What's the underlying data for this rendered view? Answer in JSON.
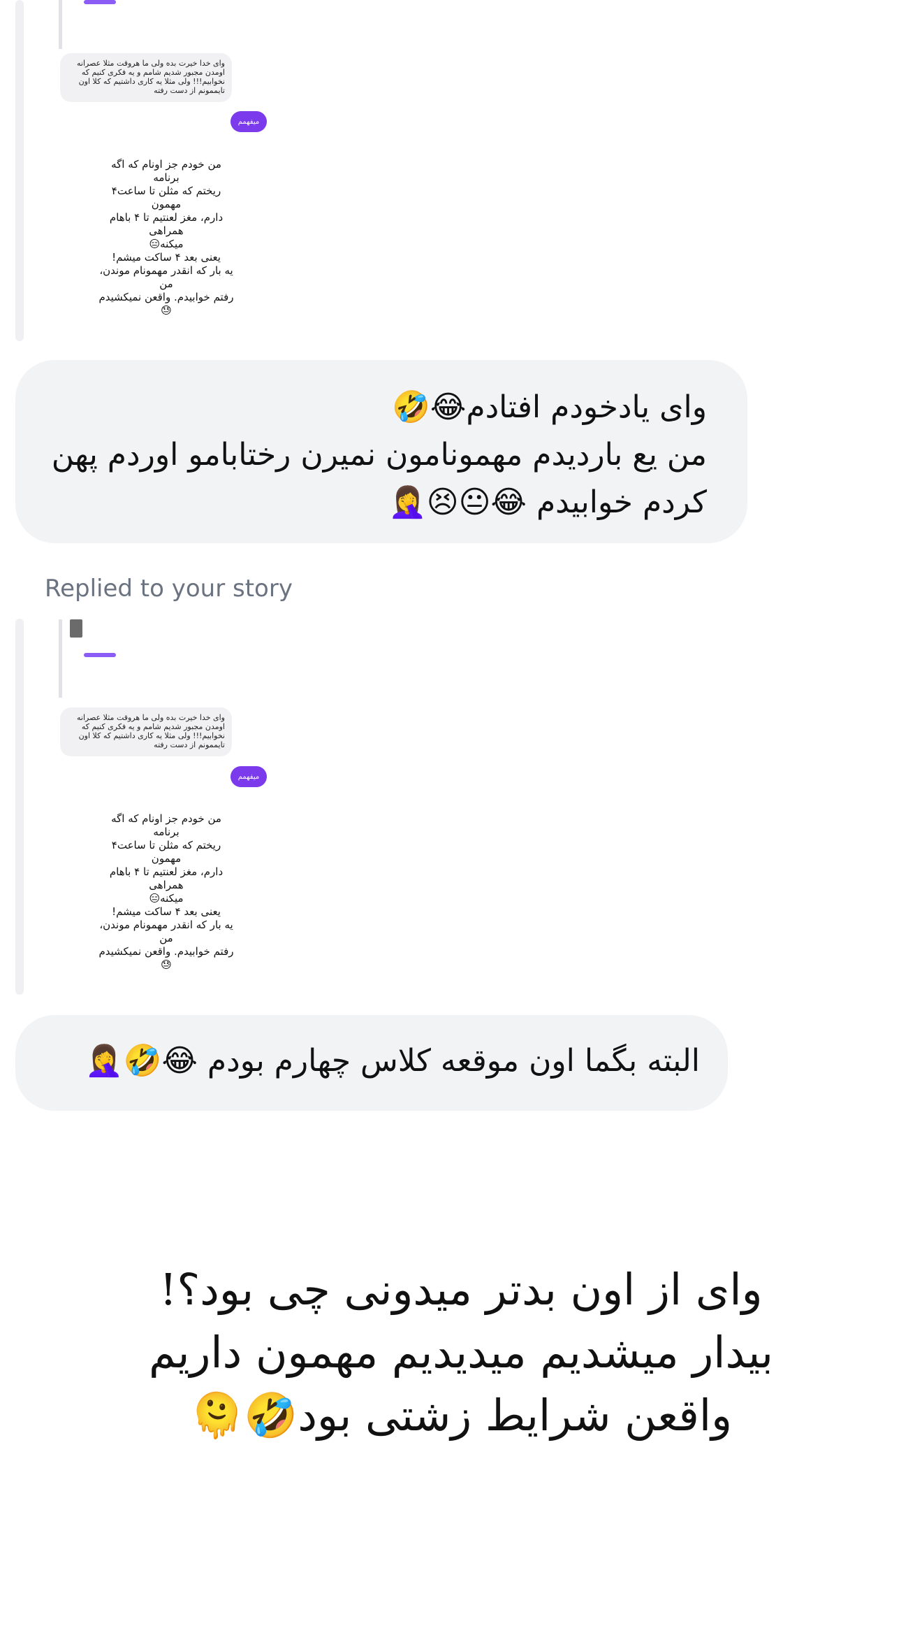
{
  "story_preview_1": {
    "pill": "میفهمم",
    "reply_bubble": "وای خدا خیرت بده ولی ما هروقت مثلا عصرانه اومدن مجبور شدیم شامم و یه فکری کنیم که نخوابیم!!! ولی مثلا یه کاری داشتیم که کلا اون تایممونم از دست رفته",
    "body_lines": [
      "من خودم جز اونام که اگه برنامه",
      "ریختم که مثلن تا ساعت۴ مهمون",
      "دارم، مغز لعنتیم تا ۴ باهام همراهی",
      "میکنه😑",
      "یعنی بعد ۴ ساکت میشم!",
      "یه بار که انقدر مهمونام موندن، من",
      "رفتم خوابیدم. واقعن نمیکشیدم😓"
    ]
  },
  "message_1": {
    "line1": "وای یادخودم افتادم😂🤣",
    "line2": "من یع باردیدم مهمونامون نمیرن رختابامو اوردم پهن",
    "line3": "کردم خوابیدم 😂😐😣🤦‍♀️"
  },
  "replied_label": "Replied to your story",
  "story_preview_2": {
    "pill": "میفهمم",
    "reply_bubble": "وای خدا خیرت بده ولی ما هروقت مثلا عصرانه اومدن مجبور شدیم شامم و یه فکری کنیم که نخوابیم!!! ولی مثلا یه کاری داشتیم که کلا اون تایممونم از دست رفته",
    "body_lines": [
      "من خودم جز اونام که اگه برنامه",
      "ریختم که مثلن تا ساعت۴ مهمون",
      "دارم، مغز لعنتیم تا ۴ باهام همراهی",
      "میکنه😑",
      "یعنی بعد ۴ ساکت میشم!",
      "یه بار که انقدر مهمونام موندن، من",
      "رفتم خوابیدم. واقعن نمیکشیدم😓"
    ]
  },
  "message_2": "البته بگما اون موقعه کلاس چهارم بودم 😂🤣🤦‍♀️",
  "caption": {
    "line1": "وای از اون بدتر میدونی چی بود؟!",
    "line2": "بیدار میشدیم میدیدیم مهمون داریم",
    "line3": "واقعن شرایط زشتی بود🤣🫠"
  }
}
